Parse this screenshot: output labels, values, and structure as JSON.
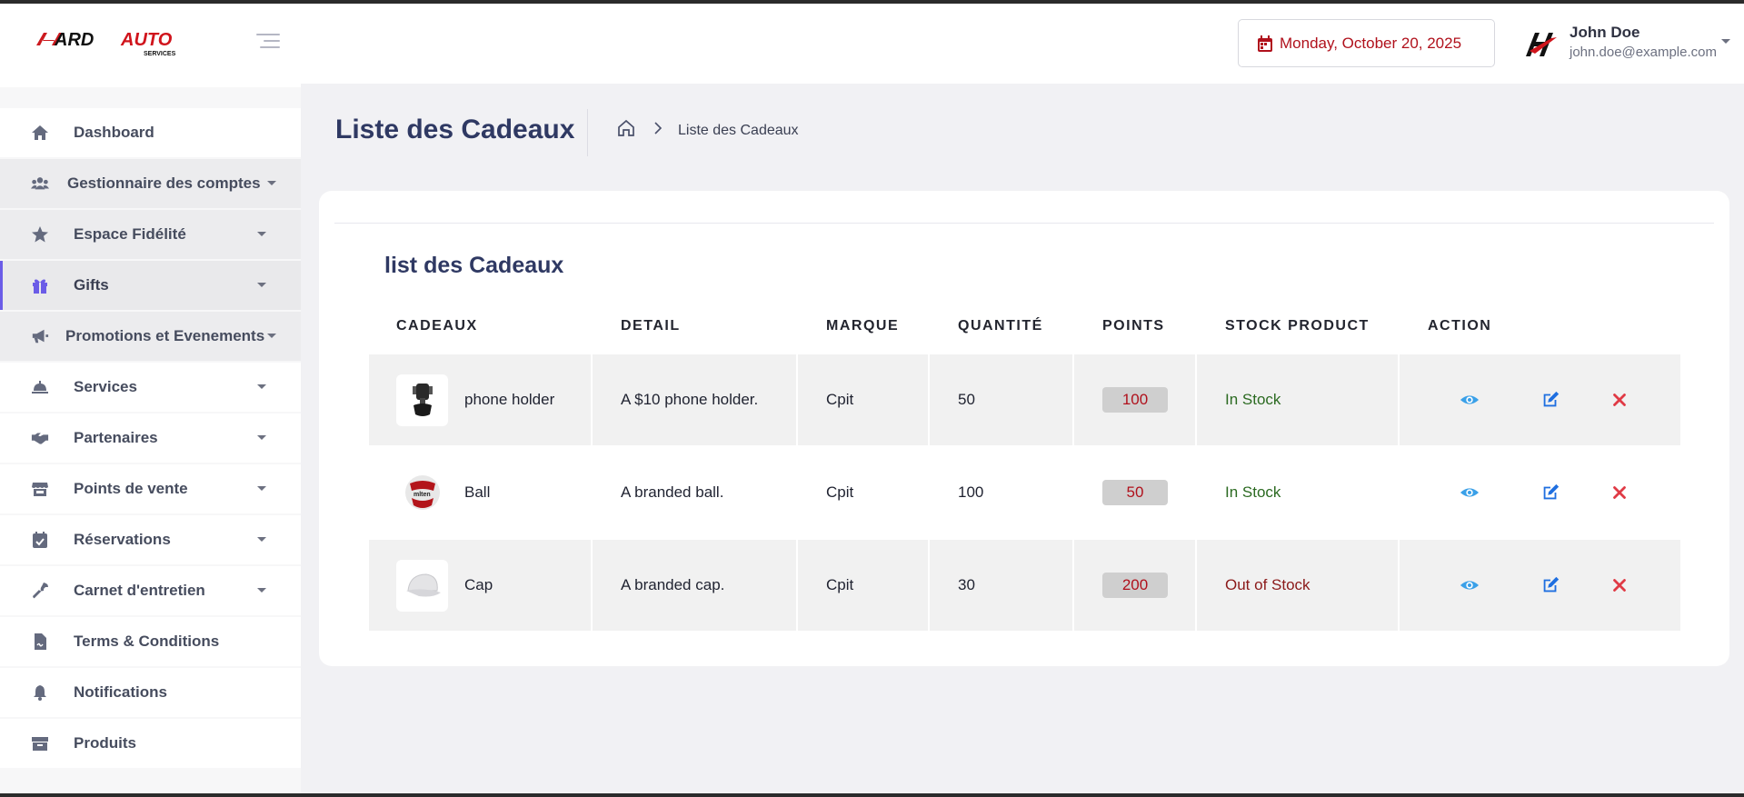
{
  "brand": {
    "logo_main": "HARD AUTO",
    "logo_sub": "SERVICES"
  },
  "sidebar": {
    "items": [
      {
        "label": "Dashboard",
        "icon": "home-icon",
        "has_caret": false
      },
      {
        "label": "Gestionnaire des comptes",
        "icon": "users-icon",
        "has_caret": true
      },
      {
        "label": "Espace Fidélité",
        "icon": "star-icon",
        "has_caret": true
      },
      {
        "label": "Gifts",
        "icon": "gift-icon",
        "has_caret": true,
        "active": true
      },
      {
        "label": "Promotions et Evenements",
        "icon": "megaphone-icon",
        "has_caret": true
      },
      {
        "label": "Services",
        "icon": "service-bell-icon",
        "has_caret": true
      },
      {
        "label": "Partenaires",
        "icon": "handshake-icon",
        "has_caret": true
      },
      {
        "label": "Points de vente",
        "icon": "store-icon",
        "has_caret": true
      },
      {
        "label": "Réservations",
        "icon": "calendar-check-icon",
        "has_caret": true
      },
      {
        "label": "Carnet d'entretien",
        "icon": "wrench-icon",
        "has_caret": true
      },
      {
        "label": "Terms & Conditions",
        "icon": "file-contract-icon",
        "has_caret": false
      },
      {
        "label": "Notifications",
        "icon": "bell-icon",
        "has_caret": false
      },
      {
        "label": "Produits",
        "icon": "box-icon",
        "has_caret": false
      }
    ]
  },
  "header": {
    "date": "Monday, October 20, 2025",
    "user_name": "John Doe",
    "user_email": "john.doe@example.com"
  },
  "page": {
    "title": "Liste des Cadeaux",
    "breadcrumb_current": "Liste des Cadeaux"
  },
  "card": {
    "title": "list des Cadeaux",
    "columns": [
      "CADEAUX",
      "DETAIL",
      "MARQUE",
      "QUANTITÉ",
      "POINTS",
      "STOCK PRODUCT",
      "ACTION"
    ],
    "rows": [
      {
        "name": "phone holder",
        "image": "phone-holder-image",
        "detail": "A $10 phone holder.",
        "brand": "Cpit",
        "quantity": "50",
        "points": "100",
        "stock": "In Stock"
      },
      {
        "name": "Ball",
        "image": "ball-image",
        "detail": "A branded ball.",
        "brand": "Cpit",
        "quantity": "100",
        "points": "50",
        "stock": "In Stock"
      },
      {
        "name": "Cap",
        "image": "cap-image",
        "detail": "A branded cap.",
        "brand": "Cpit",
        "quantity": "30",
        "points": "200",
        "stock": "Out of Stock"
      }
    ]
  },
  "colors": {
    "accent": "#6b5ce7",
    "brand_red": "#b0111c",
    "title_navy": "#2f3963",
    "in_stock": "#2b6a21",
    "out_of_stock": "#8b1a1a",
    "view_icon": "#3aa0e8",
    "edit_icon": "#1f6fe0",
    "delete_icon": "#e03a45"
  }
}
